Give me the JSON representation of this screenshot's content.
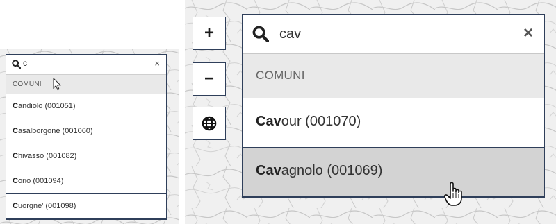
{
  "colors": {
    "border": "#2f3f5a",
    "group_bg": "#e9e9e9",
    "hover_bg": "#d3d3d3"
  },
  "small_widget": {
    "query": "c",
    "clear_icon": "×",
    "group_label": "COMUNI",
    "results": [
      {
        "match": "C",
        "rest": "andiolo (001051)"
      },
      {
        "match": "C",
        "rest": "asalborgone (001060)"
      },
      {
        "match": "C",
        "rest": "hivasso (001082)"
      },
      {
        "match": "C",
        "rest": "orio (001094)"
      },
      {
        "match": "C",
        "rest": "uorgne' (001098)"
      }
    ]
  },
  "map_controls": {
    "zoom_in": "+",
    "zoom_out": "−",
    "layers_icon": "globe-icon"
  },
  "big_widget": {
    "query": "cav",
    "clear_icon": "×",
    "group_label": "COMUNI",
    "results": [
      {
        "match": "Cav",
        "rest": "our (001070)"
      },
      {
        "match": "Cav",
        "rest": "agnolo (001069)"
      }
    ]
  }
}
